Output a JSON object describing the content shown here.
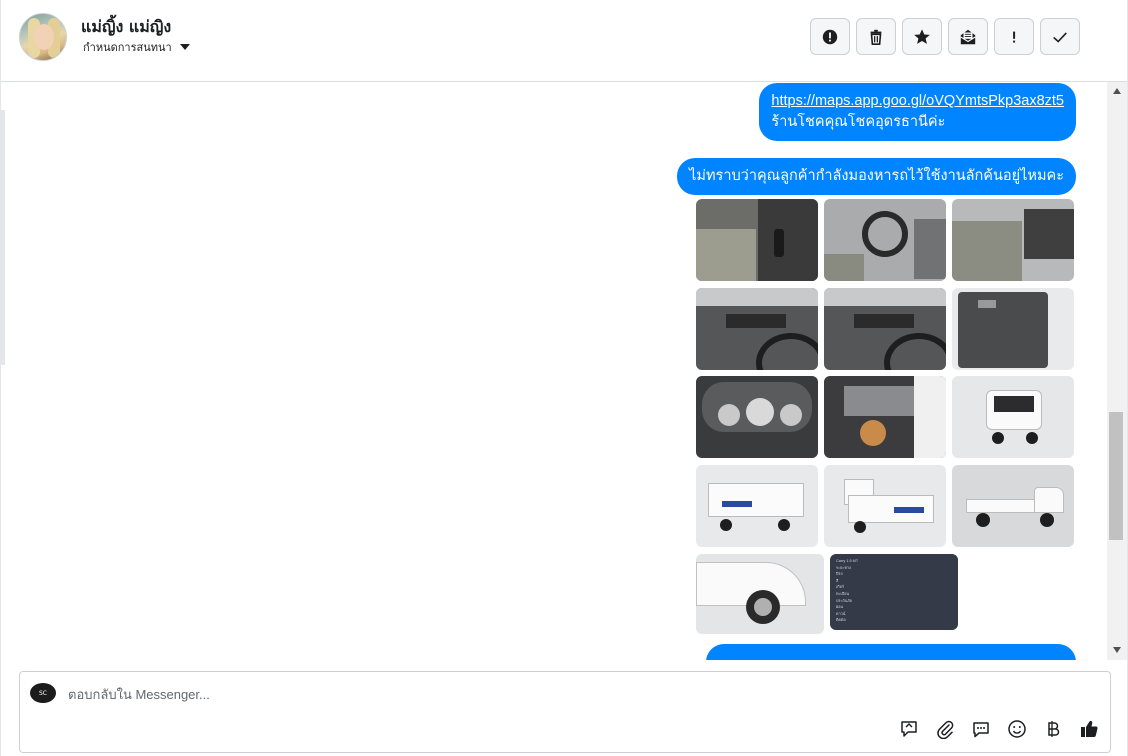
{
  "contact": {
    "name": "แม่ญิ้ง แม่ญิง",
    "status_label": "กำหนดการสนทนา"
  },
  "toolbar": {
    "buttons": [
      "report-icon",
      "trash-icon",
      "star-icon",
      "mark-unread-icon",
      "important-icon",
      "check-icon"
    ]
  },
  "messages": {
    "map_link": "https://maps.app.goo.gl/oVQYmtsPkp3ax8zt5",
    "store_text": "ร้านโชคคุณโชคอุดรธานีค่ะ",
    "question": "ไม่ทราบว่าคุณลูกค้ากำลังมองหารถไว้ใช้งานลักค้นอยู่ไหมคะ"
  },
  "photo_grid": {
    "count": 14,
    "items": [
      "seat-gear",
      "steering-wheel",
      "cab-interior",
      "dashboard-vent",
      "dashboard-vent-2",
      "door-panel",
      "gauge-cluster",
      "engine-bay",
      "truck-front",
      "truck-rear",
      "truck-rear-2",
      "truck-side",
      "truck-front-wheel",
      "spec-sheet"
    ]
  },
  "spec_sheet": {
    "rows": [
      "Carry 1.5 MT",
      "ระยะทาง",
      "ปีรถ",
      "สี",
      "เกียร์",
      "ทะเบียน",
      "ประกันภัย",
      "ผ่อน",
      "ดาวน์",
      "ติดต่อ"
    ]
  },
  "composer": {
    "placeholder": "ตอบกลับใน Messenger...",
    "page_badge": "SC"
  },
  "colors": {
    "bubble": "#0084ff",
    "bubble_text": "#ffffff"
  }
}
